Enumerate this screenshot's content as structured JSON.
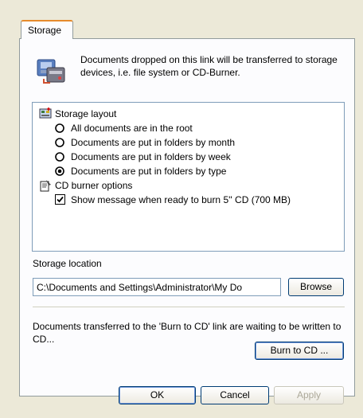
{
  "tab": {
    "label": "Storage"
  },
  "description": "Documents dropped on this link will be transferred to storage devices, i.e. file system or CD-Burner.",
  "tree": {
    "storage_layout": {
      "label": "Storage layout",
      "options": [
        {
          "label": "All documents are in the root",
          "selected": false
        },
        {
          "label": "Documents are put in folders by month",
          "selected": false
        },
        {
          "label": "Documents are put in folders by week",
          "selected": false
        },
        {
          "label": "Documents are put in folders by type",
          "selected": true
        }
      ]
    },
    "cd_burner": {
      "label": "CD burner options",
      "checkbox": {
        "label": "Show message when ready to burn 5'' CD (700 MB)",
        "checked": true
      }
    }
  },
  "storage_location": {
    "label": "Storage location",
    "value": "C:\\Documents and Settings\\Administrator\\My Do",
    "browse_label": "Browse"
  },
  "cd_message": "Documents transferred to the 'Burn to CD' link are waiting to be written to CD...",
  "burn_label": "Burn to CD ...",
  "footer": {
    "ok_label": "OK",
    "cancel_label": "Cancel",
    "apply_label": "Apply"
  },
  "icons": {
    "storage": "storage-devices-icon",
    "layout": "storage-layout-icon",
    "cd_options": "cd-burner-options-icon",
    "radio_off": "radio-unselected",
    "radio_on": "radio-selected",
    "checkbox_on": "checkbox-checked"
  }
}
